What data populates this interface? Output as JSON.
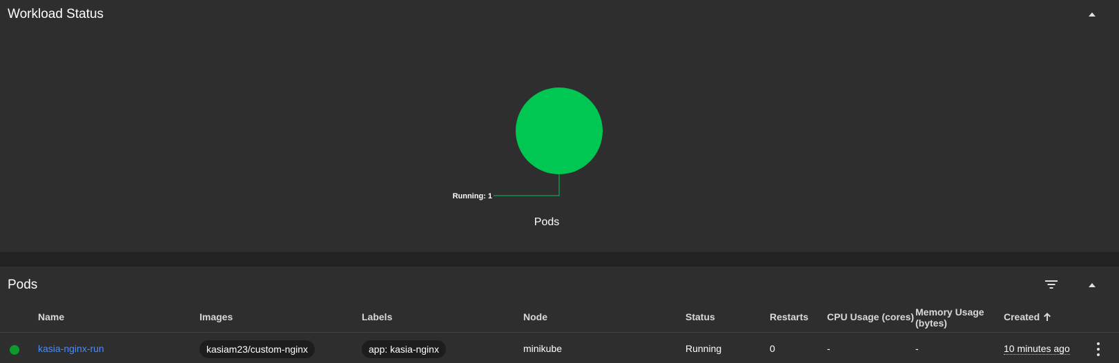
{
  "workload": {
    "title": "Workload Status"
  },
  "chart_data": {
    "type": "pie",
    "categories": [
      "Running"
    ],
    "values": [
      1
    ],
    "slice_labels": [
      "Running: 1"
    ],
    "colors": [
      "#00c752"
    ],
    "title": "Pods"
  },
  "pods": {
    "title": "Pods",
    "filter_icon": "filter-list-icon",
    "collapse_icon": "chevron-up-icon",
    "columns": [
      "Name",
      "Images",
      "Labels",
      "Node",
      "Status",
      "Restarts",
      "CPU Usage (cores)",
      "Memory Usage",
      "(bytes)",
      "Created"
    ],
    "sort_icon": "arrow-up-icon",
    "rows": [
      {
        "name": "kasia-nginx-run",
        "image": "kasiam23/custom-nginx",
        "label": "app: kasia-nginx",
        "node": "minikube",
        "status": "Running",
        "restarts": "0",
        "cpu": "-",
        "memory": "-",
        "created": "10 minutes ago",
        "status_color": "#0d9a2b"
      }
    ]
  }
}
